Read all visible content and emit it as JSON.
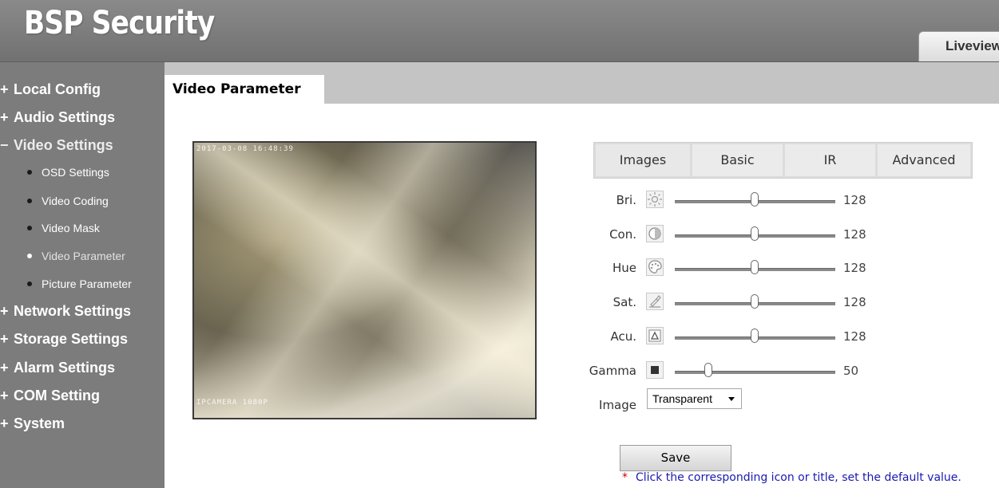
{
  "header": {
    "brand": "BSP Security",
    "liveview_tab": "Liveview"
  },
  "sidebar": {
    "items": [
      {
        "sign": "+",
        "label": "Local Config"
      },
      {
        "sign": "+",
        "label": "Audio Settings"
      },
      {
        "sign": "−",
        "label": "Video Settings"
      },
      {
        "label": "OSD Settings"
      },
      {
        "label": "Video Coding"
      },
      {
        "label": "Video Mask"
      },
      {
        "label": "Video Parameter",
        "active": true
      },
      {
        "label": "Picture Parameter"
      },
      {
        "sign": "+",
        "label": "Network Settings"
      },
      {
        "sign": "+",
        "label": "Storage Settings"
      },
      {
        "sign": "+",
        "label": "Alarm Settings"
      },
      {
        "sign": "+",
        "label": "COM Setting"
      },
      {
        "sign": "+",
        "label": "System"
      }
    ]
  },
  "page": {
    "tab_title": "Video Parameter"
  },
  "video": {
    "osd_top": "2017-03-08 16:48:39",
    "osd_bottom": "IPCAMERA 1080P"
  },
  "param_tabs": [
    "Images",
    "Basic",
    "IR",
    "Advanced"
  ],
  "sliders": [
    {
      "label": "Bri.",
      "icon": "brightness-icon",
      "value": "128",
      "level": 0.5
    },
    {
      "label": "Con.",
      "icon": "contrast-icon",
      "value": "128",
      "level": 0.5
    },
    {
      "label": "Hue",
      "icon": "palette-icon",
      "value": "128",
      "level": 0.5
    },
    {
      "label": "Sat.",
      "icon": "saturation-icon",
      "value": "128",
      "level": 0.5
    },
    {
      "label": "Acu.",
      "icon": "sharpness-icon",
      "value": "128",
      "level": 0.5
    },
    {
      "label": "Gamma",
      "icon": "gamma-icon",
      "value": "50",
      "level": 0.2
    }
  ],
  "image_mode": {
    "label": "Image",
    "selected": "Transparent"
  },
  "save_label": "Save",
  "hint": {
    "marker": "*",
    "text": "Click the corresponding icon or title, set the default value."
  },
  "colors": {
    "sidebar_bg": "#7c7c7c",
    "header_bg": "#7b7b7b",
    "hint_text": "#1a1ab0",
    "hint_marker": "#d00000"
  }
}
